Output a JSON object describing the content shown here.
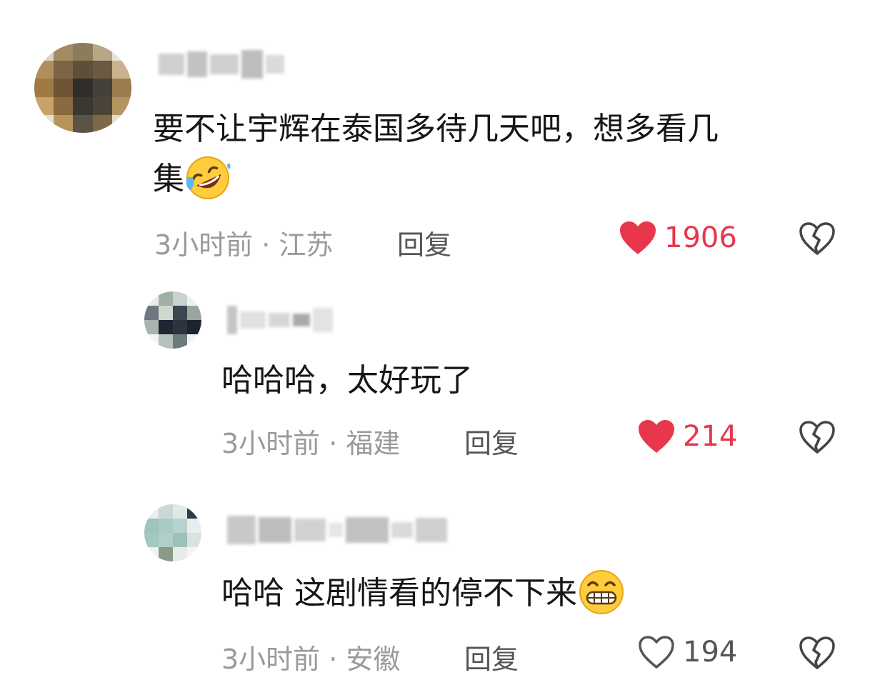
{
  "colors": {
    "like_active": "#e8364d",
    "muted_text": "#9a9a9a",
    "reply_text": "#555555"
  },
  "comments": [
    {
      "text_line1": "要不让宇辉在泰国多待几天吧，想多看几",
      "text_line2": "集",
      "emoji": "rolling-on-floor-laughing-emoji",
      "time": "3小时前",
      "location": "江苏",
      "meta": "3小时前 · 江苏",
      "reply_label": "回复",
      "likes": "1906",
      "liked": true,
      "dislike_icon": "broken-heart-icon"
    },
    {
      "text": "哈哈哈，太好玩了",
      "time": "3小时前",
      "location": "福建",
      "meta": "3小时前 · 福建",
      "reply_label": "回复",
      "likes": "214",
      "liked": true,
      "dislike_icon": "broken-heart-icon"
    },
    {
      "text": "哈哈 这剧情看的停不下来",
      "emoji": "grinning-face-emoji",
      "time": "3小时前",
      "location": "安徽",
      "meta": "3小时前 · 安徽",
      "reply_label": "回复",
      "likes": "194",
      "liked": false,
      "dislike_icon": "broken-heart-icon"
    }
  ]
}
